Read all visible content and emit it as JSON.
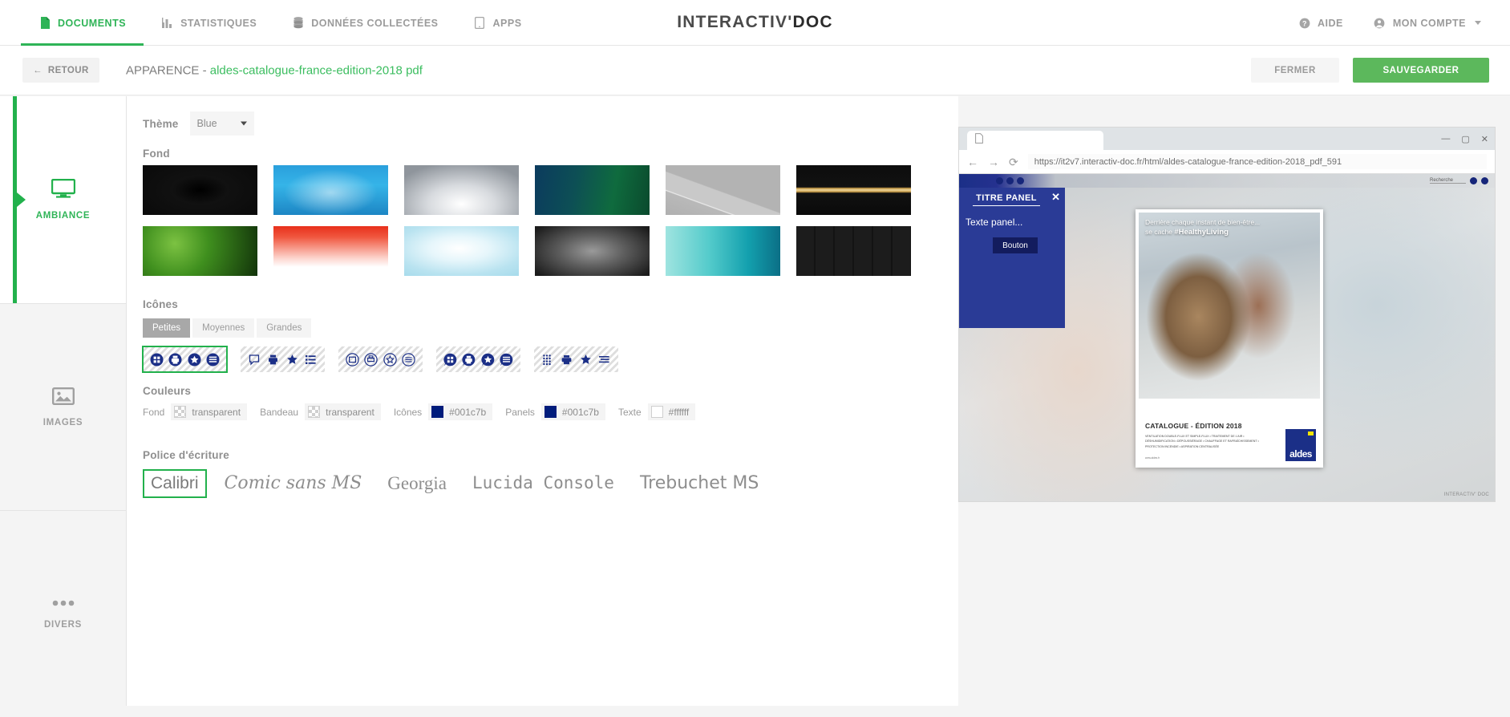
{
  "topnav": {
    "items": [
      {
        "label": "DOCUMENTS",
        "icon": "document-icon",
        "active": true
      },
      {
        "label": "STATISTIQUES",
        "icon": "chart-bar-icon",
        "active": false
      },
      {
        "label": "DONNÉES COLLECTÉES",
        "icon": "database-icon",
        "active": false
      },
      {
        "label": "APPS",
        "icon": "tablet-icon",
        "active": false
      }
    ],
    "brand_1": "INTERACTIV'",
    "brand_2": "DOC",
    "help_label": "AIDE",
    "account_label": "MON COMPTE"
  },
  "subheader": {
    "back_label": "RETOUR",
    "title_prefix": "APPARENCE - ",
    "document_name": "aldes-catalogue-france-edition-2018 pdf",
    "close_label": "FERMER",
    "save_label": "SAUVEGARDER"
  },
  "sidebar": {
    "items": [
      {
        "label": "AMBIANCE",
        "icon": "monitor-icon",
        "active": true
      },
      {
        "label": "IMAGES",
        "icon": "picture-icon",
        "active": false
      },
      {
        "label": "DIVERS",
        "icon": "ellipsis-icon",
        "active": false
      }
    ]
  },
  "main": {
    "theme": {
      "label": "Thème",
      "value": "Blue"
    },
    "fond": {
      "label": "Fond",
      "thumbs": [
        {
          "name": "dark-polygon",
          "selected": false
        },
        {
          "name": "blue-bokeh",
          "selected": false
        },
        {
          "name": "grey-gradient",
          "selected": false
        },
        {
          "name": "teal-green-grunge",
          "selected": false
        },
        {
          "name": "grey-origami",
          "selected": false
        },
        {
          "name": "black-gold-line",
          "selected": false
        },
        {
          "name": "green-leaves",
          "selected": false
        },
        {
          "name": "red-white-fade",
          "selected": false
        },
        {
          "name": "light-blue-clouds",
          "selected": false
        },
        {
          "name": "dark-concrete",
          "selected": false
        },
        {
          "name": "turquoise-water",
          "selected": false
        },
        {
          "name": "black-bricks",
          "selected": false
        }
      ]
    },
    "icones": {
      "label": "Icônes",
      "sizes": [
        {
          "label": "Petites",
          "active": true
        },
        {
          "label": "Moyennes",
          "active": false
        },
        {
          "label": "Grandes",
          "active": false
        }
      ],
      "sets": [
        {
          "name": "iconset-filled-round",
          "selected": true
        },
        {
          "name": "iconset-outline-flat",
          "selected": false
        },
        {
          "name": "iconset-outline-round",
          "selected": false
        },
        {
          "name": "iconset-filled-bubble",
          "selected": false
        },
        {
          "name": "iconset-solid-mixed",
          "selected": false
        }
      ]
    },
    "couleurs": {
      "label": "Couleurs",
      "fields": [
        {
          "caption": "Fond",
          "value": "transparent",
          "swatch": "transparent"
        },
        {
          "caption": "Bandeau",
          "value": "transparent",
          "swatch": "transparent"
        },
        {
          "caption": "Icônes",
          "value": "#001c7b",
          "swatch": "#001c7b"
        },
        {
          "caption": "Panels",
          "value": "#001c7b",
          "swatch": "#001c7b"
        },
        {
          "caption": "Texte",
          "value": "#ffffff",
          "swatch": "#ffffff"
        }
      ]
    },
    "police": {
      "label": "Police d'écriture",
      "fonts": [
        {
          "label": "Calibri",
          "css": "f-calibri",
          "active": true
        },
        {
          "label": "Comic sans MS",
          "css": "f-comic",
          "active": false
        },
        {
          "label": "Georgia",
          "css": "f-georgia",
          "active": false
        },
        {
          "label": "Lucida Console",
          "css": "f-lucida",
          "active": false
        },
        {
          "label": "Trebuchet MS",
          "css": "f-trebuchet",
          "active": false
        }
      ]
    }
  },
  "preview": {
    "url": "https://it2v7.interactiv-doc.fr/html/aldes-catalogue-france-edition-2018_pdf_591",
    "win_minimize": "—",
    "win_maximize": "▢",
    "win_close": "✕",
    "nav_back": "←",
    "nav_forward": "→",
    "nav_reload": "⟳",
    "ribbon_search": "Recherche",
    "brand_watermark": "aldes",
    "panel": {
      "title": "TITRE PANEL",
      "close": "✕",
      "text": "Texte panel...",
      "button_label": "Bouton"
    },
    "cover": {
      "headline_1": "Derrière chaque instant de bien-être...",
      "headline_2": "se cache ",
      "headline_hashtag": "#HealthyLiving",
      "title": "CATALOGUE - ÉDITION 2018",
      "subtitle": "VENTILATION DOUBLE-FLUX ET SIMPLE-FLUX • TRAITEMENT DE L'AIR • DÉSHUMIDIFICATION • DÉPOUSSIÉRAGE • CHAUFFAGE ET RAFRAÎCHISSEMENT • PROTECTION INCENDIE • ASPIRATION CENTRALISÉE",
      "footnote": "www.aldes.fr",
      "logo": "aldes"
    },
    "watermark": "INTERACTIV' DOC"
  }
}
